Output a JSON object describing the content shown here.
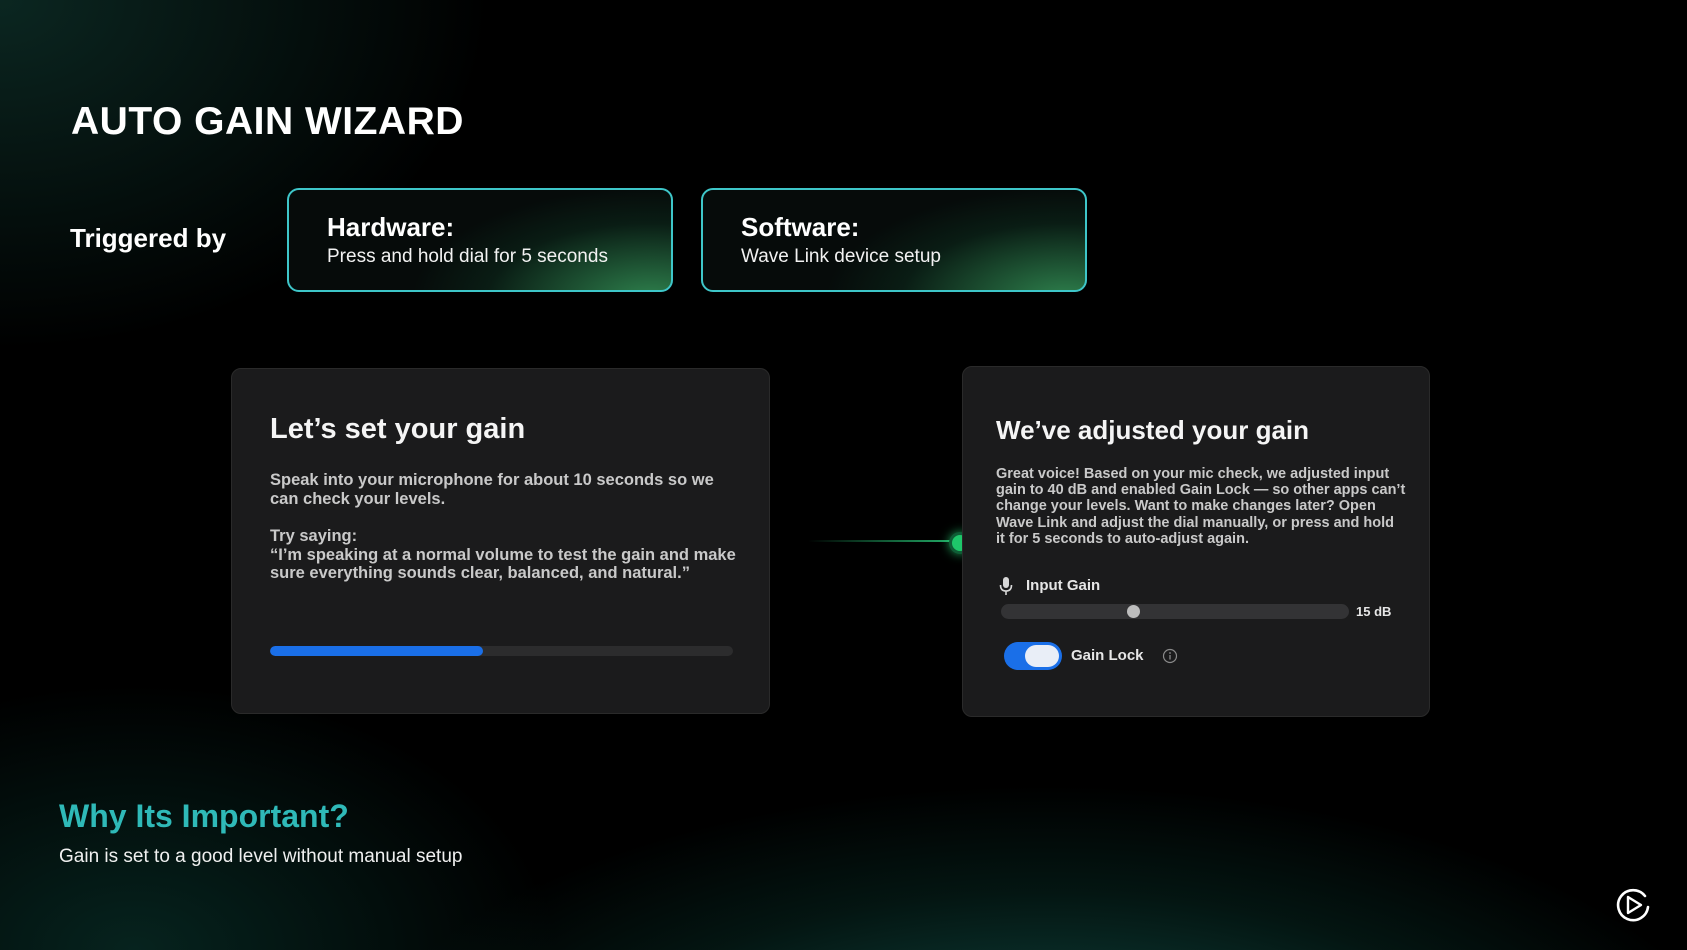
{
  "page": {
    "title": "AUTO GAIN WIZARD",
    "triggered_by_label": "Triggered by"
  },
  "triggers": [
    {
      "title": "Hardware:",
      "desc": "Press and hold dial for 5 seconds"
    },
    {
      "title": "Software:",
      "desc": "Wave Link device setup"
    }
  ],
  "setup_panel": {
    "title": "Let’s set your gain",
    "body": "Speak into your microphone for about 10 seconds so we can check your levels.",
    "try_label": "Try saying:",
    "try_quote": "“I’m speaking at a normal volume to test the gain and make sure everything sounds clear, balanced, and natural.”",
    "progress_percent": 46
  },
  "result_panel": {
    "title": "We’ve adjusted your gain",
    "body": "Great voice! Based on your mic check, we adjusted input gain to 40 dB and enabled Gain Lock — so other apps can’t change your levels. Want to make changes later? Open Wave Link and adjust the dial manually, or press and hold it for 5 seconds to auto-adjust again.",
    "input_gain_label": "Input Gain",
    "slider_fraction": 0.38,
    "slider_value": "15 dB",
    "gain_lock_label": "Gain Lock",
    "gain_lock_on": true
  },
  "why": {
    "title": "Why Its Important?",
    "desc": "Gain is set to a good level without manual setup"
  },
  "icons": {
    "mic": "microphone-icon",
    "info": "info-icon",
    "logo": "elgato-logo-icon"
  },
  "colors": {
    "accent_blue": "#1a6fe8",
    "card_border": "#3ec6c9",
    "why_title": "#2fb9b8",
    "connector": "#1ec76a"
  }
}
